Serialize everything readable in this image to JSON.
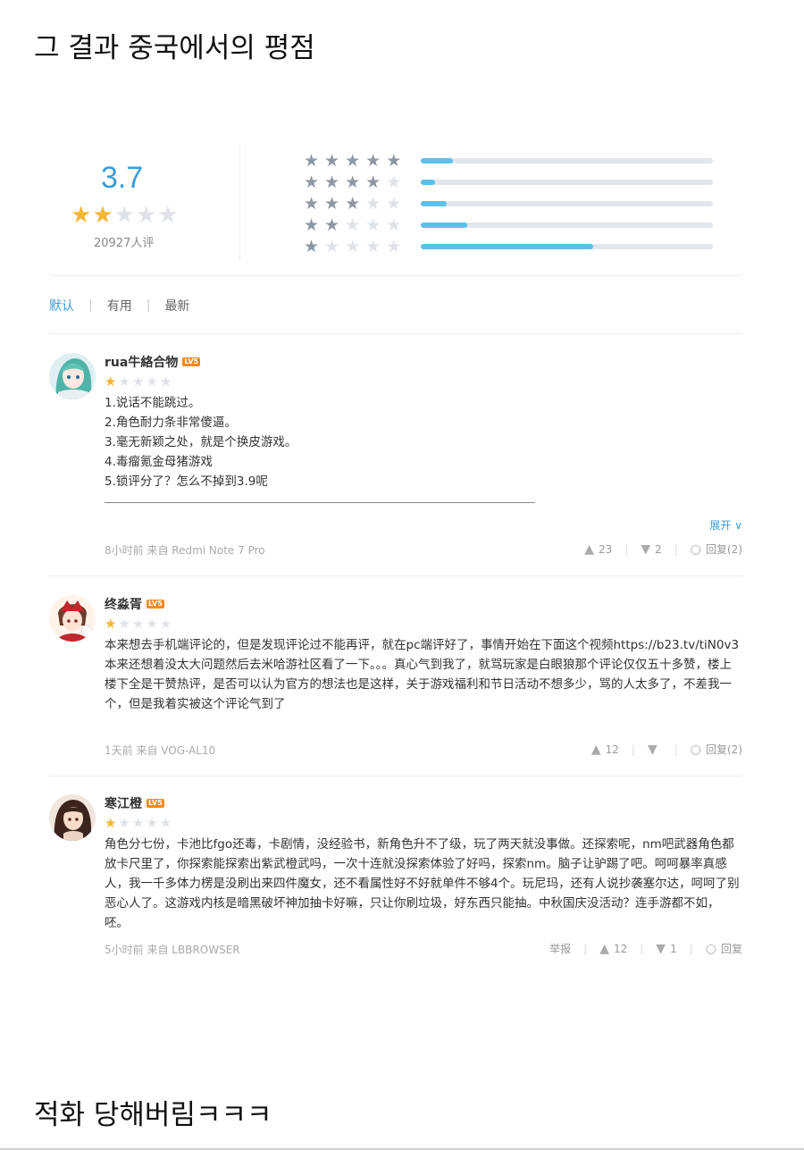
{
  "captions": {
    "top": "그 결과 중국에서의 평점",
    "bottom": "적화 당해버림ㅋㅋㅋ"
  },
  "summary": {
    "score": "3.7",
    "score_stars_filled": 2,
    "rating_count": "20927人评",
    "distribution": [
      {
        "stars": 5,
        "fraction": 0.11
      },
      {
        "stars": 4,
        "fraction": 0.05
      },
      {
        "stars": 3,
        "fraction": 0.09
      },
      {
        "stars": 2,
        "fraction": 0.16
      },
      {
        "stars": 1,
        "fraction": 0.59
      }
    ]
  },
  "tabs": [
    {
      "label": "默认",
      "active": true
    },
    {
      "label": "有用",
      "active": false
    },
    {
      "label": "最新",
      "active": false
    }
  ],
  "reviews": [
    {
      "user": "rua牛絡合物",
      "level": "LV5",
      "stars": 1,
      "lines": [
        "1.说话不能跳过。",
        "2.角色耐力条非常傻逼。",
        "3.毫无新颖之处，就是个换皮游戏。",
        "4.毒瘤氪金母猪游戏",
        "5.锁评分了？怎么不掉到3.9呢"
      ],
      "expand": "展开 ∨",
      "meta": "8小时前 来自 Redmi Note 7 Pro",
      "report": "",
      "likes": "23",
      "dislikes": "2",
      "reply": "回复(2)"
    },
    {
      "user": "终淼胥",
      "level": "LV5",
      "stars": 1,
      "lines": [
        "本来想去手机端评论的，但是发现评论过不能再评，就在pc端评好了，事情开始在下面这个视频https://b23.tv/tiN0v3",
        "本来还想着没太大问题然后去米哈游社区看了一下。。。真心气到我了，就骂玩家是白眼狼那个评论仅仅五十多赞，楼上楼下全是干赞热评，是否可以认为官方的想法也是这样，关于游戏福利和节日活动不想多少，骂的人太多了，不差我一个，但是我着实被这个评论气到了"
      ],
      "meta": "1天前 来自 VOG-AL10",
      "report": "",
      "likes": "12",
      "dislikes": "",
      "reply": "回复(2)"
    },
    {
      "user": "寒江橙",
      "level": "LV5",
      "stars": 1,
      "lines": [
        "角色分七份，卡池比fgo还毒，卡剧情，没经验书，新角色升不了级，玩了两天就没事做。还探索呢，nm吧武器角色都放卡尺里了，你探索能探索出紫武橙武吗，一次十连就没探索体验了好吗，探索nm。脑子让驴踢了吧。呵呵暴率真感人，我一千多体力楞是没刷出来四件魔女，还不看属性好不好就单件不够4个。玩尼玛，还有人说抄袭塞尔达，呵呵了别恶心人了。这游戏内核是暗黑破坏神加抽卡好嘛，只让你刷垃圾，好东西只能抽。中秋国庆没活动？连手游都不如，呸。"
      ],
      "meta": "5小时前 来自 LBBROWSER",
      "report": "举报",
      "likes": "12",
      "dislikes": "1",
      "reply": "回复"
    }
  ],
  "colors": {
    "accent": "#3a9cd8",
    "star": "#f5b531",
    "bar_fill": "#5cc0e8",
    "bar_track": "#e2e5ea",
    "level_badge": "#f08a1c"
  },
  "icons": {
    "like": "thumbs-up-icon",
    "dislike": "thumbs-down-icon",
    "reply": "speech-bubble-icon",
    "expand": "chevron-down-icon"
  }
}
